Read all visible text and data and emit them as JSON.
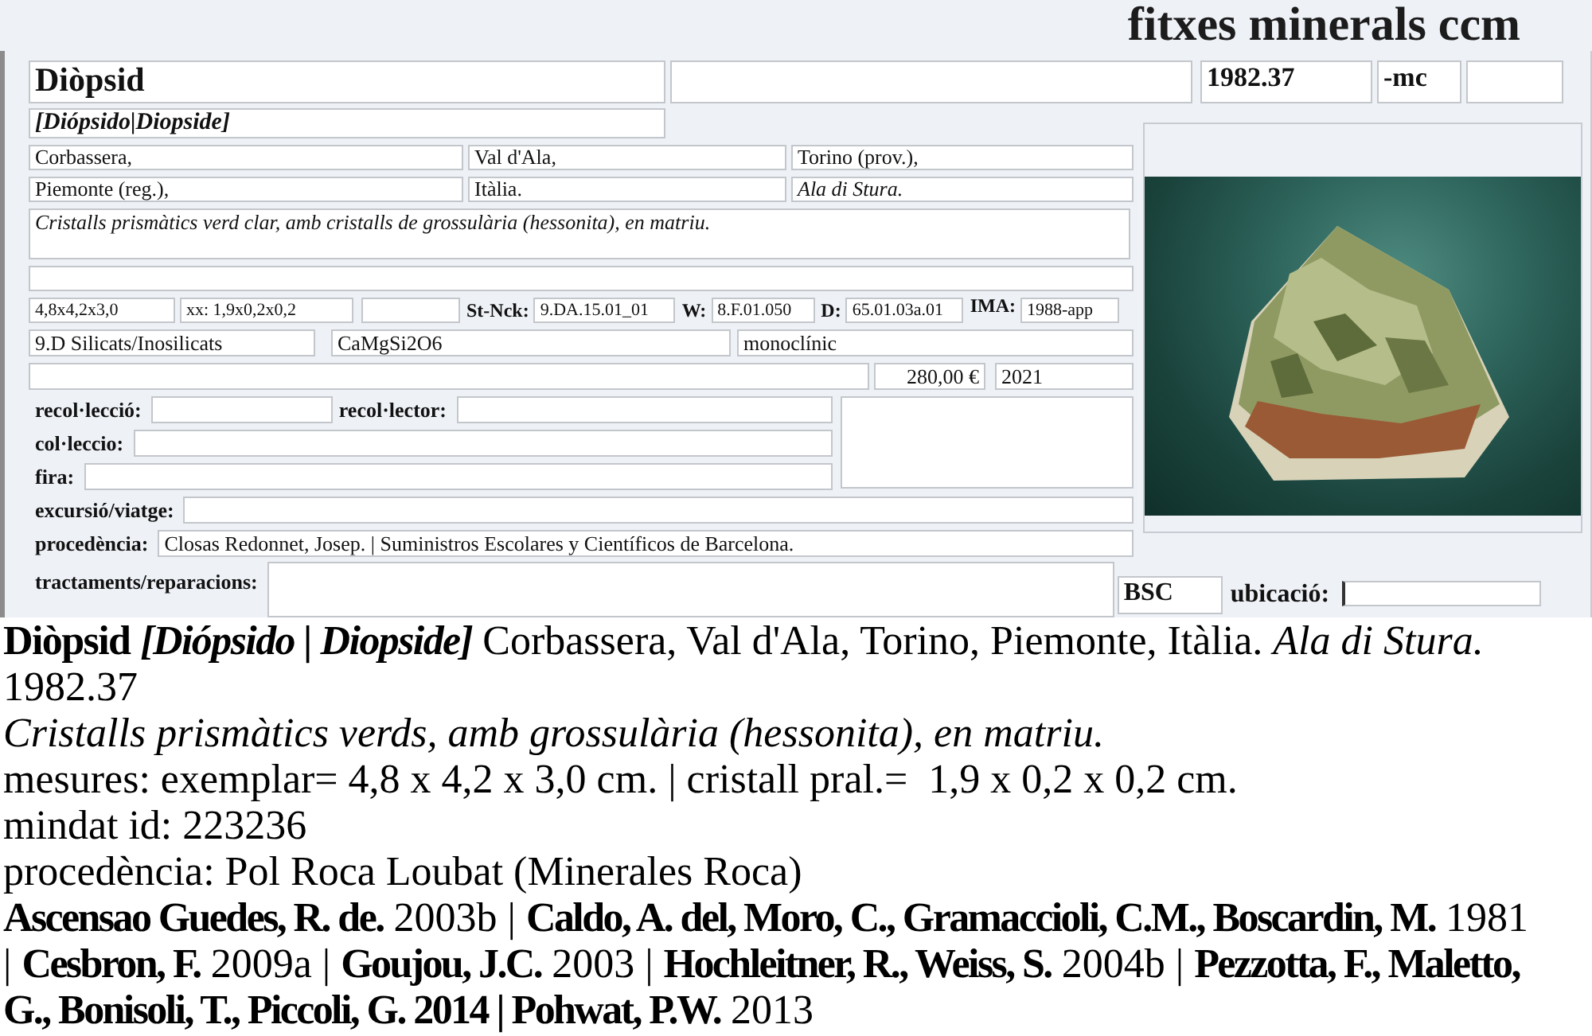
{
  "header": {
    "title": "fitxes minerals ccm"
  },
  "record": {
    "name": "Diòpsid",
    "catalog_number": "1982.37",
    "suffix": "-mc",
    "synonyms": "[Diópsido|Diopside]",
    "locality": [
      {
        "text": "Corbassera,",
        "kind": "region"
      },
      {
        "text": "Val d'Ala,",
        "kind": "region"
      },
      {
        "text": "Torino (prov.),",
        "kind": "region"
      },
      {
        "text": "Piemonte (reg.),",
        "kind": "region"
      },
      {
        "text": "Itàlia.",
        "kind": "region"
      },
      {
        "text": "Ala di Stura.",
        "kind": "site"
      }
    ],
    "description": "Cristalls prismàtics verd clar, amb cristalls de grossulària (hessonita), en matriu.",
    "size": "4,8x4,2x3,0",
    "crystal_size": "xx: 1,9x0,2x0,2",
    "classifications": [
      {
        "label": "St-Nck:",
        "value": "9.DA.15.01_01"
      },
      {
        "label": "W:",
        "value": "8.F.01.050"
      },
      {
        "label": "D:",
        "value": "65.01.03a.01"
      },
      {
        "label": "IMA:",
        "value": "1988-app"
      }
    ],
    "mineral_class": "9.D Silicats/Inosilicats",
    "formula": "CaMgSi2O6",
    "crystal_system": "monoclínic",
    "price": "280,00 €",
    "year": "2021",
    "collection_fields": [
      {
        "label": "recol·lecció:"
      },
      {
        "label": "recol·lector:"
      },
      {
        "label": "col·leccio:"
      },
      {
        "label": "fira:"
      }
    ],
    "origin_fields": [
      {
        "label": "excursió/viatge:"
      },
      {
        "label": "procedència:",
        "value": "Closas Redonnet, Josep. | Suministros Escolares y Científicos de Barcelona."
      }
    ],
    "treatments": {
      "label": "tractaments/reparacions:"
    },
    "storage": {
      "code": "BSC",
      "location_label": "ubicació:"
    }
  },
  "notes": {
    "heading": [
      {
        "text": "Diòpsid",
        "kind": "name"
      },
      {
        "text": "[Diópsido | Diopside]",
        "kind": "synonyms"
      },
      {
        "text": "Corbassera, Val d'Ala, Torino, Piemonte, Itàlia.",
        "kind": "place"
      },
      {
        "text": "Ala di Stura.",
        "kind": "site"
      }
    ],
    "catalog_number": "1982.37",
    "description": "Cristalls prismàtics verds, amb grossulària (hessonita), en matriu.",
    "measurements": "mesures: exemplar= 4,8 x 4,2 x 3,0 cm. | cristall pral.=  1,9 x 0,2 x 0,2 cm.",
    "mindat": "mindat id: 223236",
    "provenance": "procedència: Pol Roca Loubat (Minerales Roca)",
    "references": "**Ascensao Guedes, R. de.** 2003b | **Caldo, A. del, Moro, C., Gramaccioli, C.M., Boscardin, M.** 1981 | **Cesbron, F.** 2009a | **Goujou, J.C.** 2003 | **Hochleitner, R., Weiss, S.** 2004b | **Pezzotta, F., Maletto, G., Bonisoli, T., Piccoli, G. 2014 | Pohwat, P.W.** 2013"
  }
}
